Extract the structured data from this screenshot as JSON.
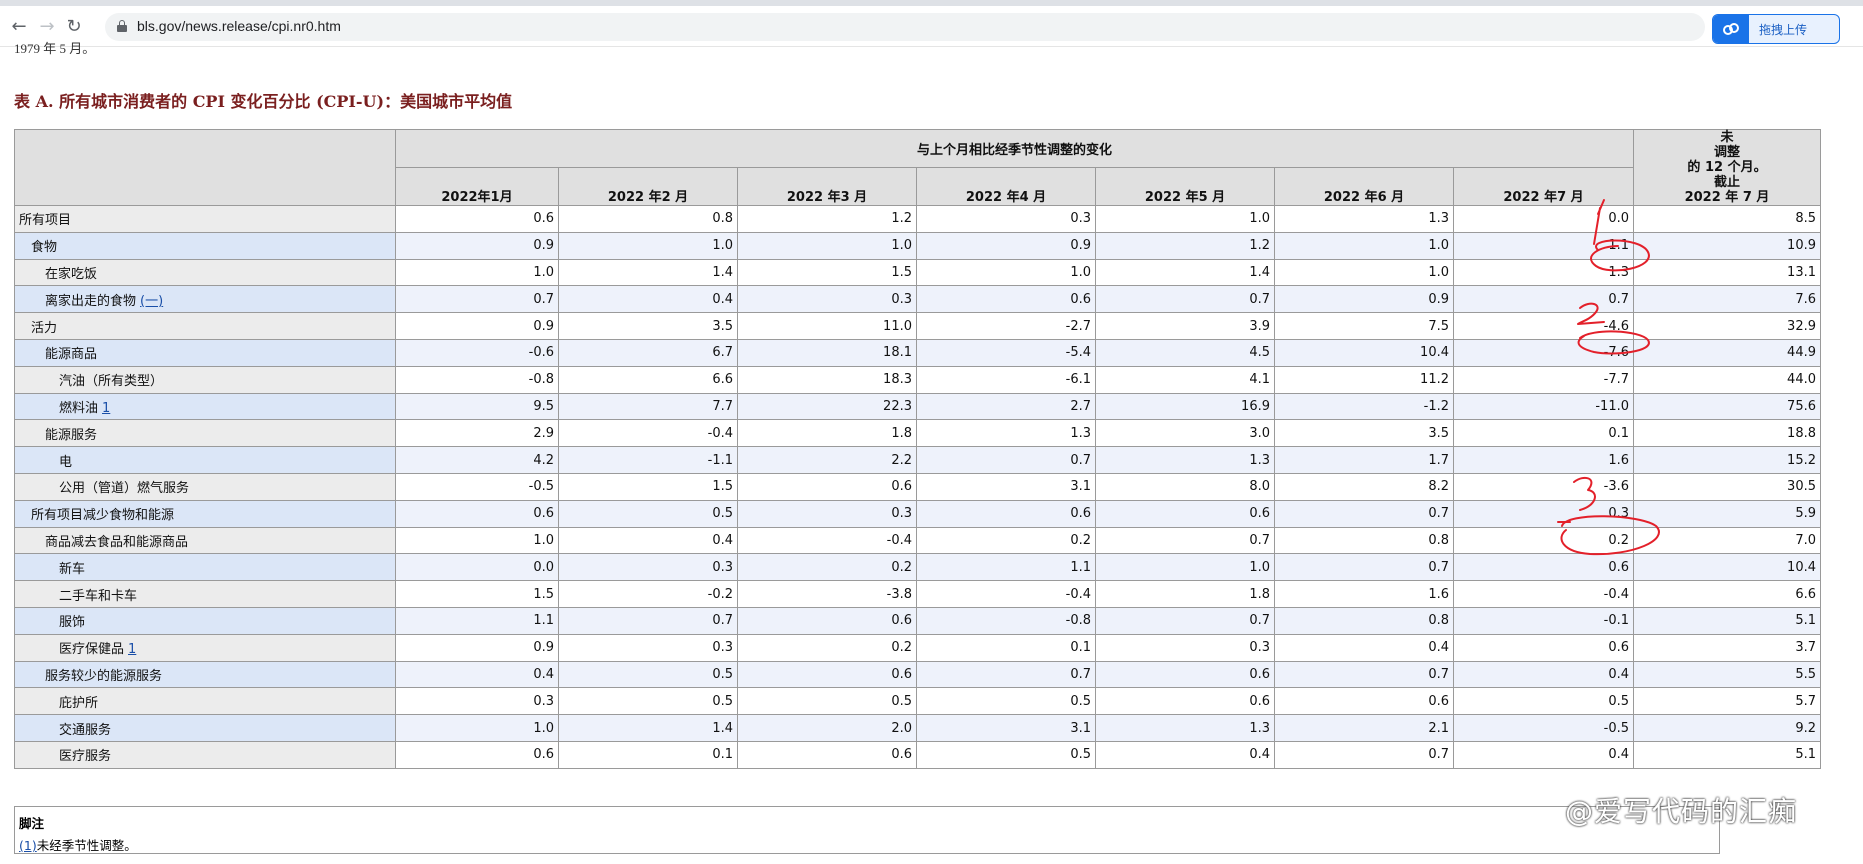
{
  "browser": {
    "url": "bls.gov/news.release/cpi.nr0.htm",
    "upload_label": "拖拽上传"
  },
  "page": {
    "prev_line": "1979 年 5 月。",
    "table_title": "表 A. 所有城市消费者的 CPI 变化百分比 (CPI-U)：美国城市平均值",
    "group_header": "与上个月相比经季节性调整的变化",
    "unadjusted_header": [
      "未",
      "调整",
      "的 12 个月。",
      "截止",
      "2022 年 7 月"
    ],
    "months": [
      "2022年1月",
      "2022 年2 月",
      "2022 年3 月",
      "2022 年4 月",
      "2022 年5 月",
      "2022 年6 月",
      "2022 年7 月"
    ],
    "rows": [
      {
        "label": "所有项目",
        "indent": 0,
        "values": [
          "0.6",
          "0.8",
          "1.2",
          "0.3",
          "1.0",
          "1.3",
          "0.0",
          "8.5"
        ]
      },
      {
        "label": "食物",
        "indent": 1,
        "values": [
          "0.9",
          "1.0",
          "1.0",
          "0.9",
          "1.2",
          "1.0",
          "1.1",
          "10.9"
        ]
      },
      {
        "label": "在家吃饭",
        "indent": 2,
        "values": [
          "1.0",
          "1.4",
          "1.5",
          "1.0",
          "1.4",
          "1.0",
          "1.3",
          "13.1"
        ]
      },
      {
        "label": "离家出走的食物",
        "indent": 2,
        "fn": "(一)",
        "values": [
          "0.7",
          "0.4",
          "0.3",
          "0.6",
          "0.7",
          "0.9",
          "0.7",
          "7.6"
        ]
      },
      {
        "label": "活力",
        "indent": 1,
        "values": [
          "0.9",
          "3.5",
          "11.0",
          "-2.7",
          "3.9",
          "7.5",
          "-4.6",
          "32.9"
        ]
      },
      {
        "label": "能源商品",
        "indent": 2,
        "values": [
          "-0.6",
          "6.7",
          "18.1",
          "-5.4",
          "4.5",
          "10.4",
          "-7.6",
          "44.9"
        ]
      },
      {
        "label": "汽油（所有类型）",
        "indent": 3,
        "values": [
          "-0.8",
          "6.6",
          "18.3",
          "-6.1",
          "4.1",
          "11.2",
          "-7.7",
          "44.0"
        ]
      },
      {
        "label": "燃料油",
        "indent": 3,
        "fn": "1",
        "values": [
          "9.5",
          "7.7",
          "22.3",
          "2.7",
          "16.9",
          "-1.2",
          "-11.0",
          "75.6"
        ]
      },
      {
        "label": "能源服务",
        "indent": 2,
        "values": [
          "2.9",
          "-0.4",
          "1.8",
          "1.3",
          "3.0",
          "3.5",
          "0.1",
          "18.8"
        ]
      },
      {
        "label": "电",
        "indent": 3,
        "values": [
          "4.2",
          "-1.1",
          "2.2",
          "0.7",
          "1.3",
          "1.7",
          "1.6",
          "15.2"
        ]
      },
      {
        "label": "公用（管道）燃气服务",
        "indent": 3,
        "values": [
          "-0.5",
          "1.5",
          "0.6",
          "3.1",
          "8.0",
          "8.2",
          "-3.6",
          "30.5"
        ]
      },
      {
        "label": "所有项目减少食物和能源",
        "indent": 1,
        "values": [
          "0.6",
          "0.5",
          "0.3",
          "0.6",
          "0.6",
          "0.7",
          "0.3",
          "5.9"
        ]
      },
      {
        "label": "商品减去食品和能源商品",
        "indent": 2,
        "values": [
          "1.0",
          "0.4",
          "-0.4",
          "0.2",
          "0.7",
          "0.8",
          "0.2",
          "7.0"
        ]
      },
      {
        "label": "新车",
        "indent": 3,
        "values": [
          "0.0",
          "0.3",
          "0.2",
          "1.1",
          "1.0",
          "0.7",
          "0.6",
          "10.4"
        ]
      },
      {
        "label": "二手车和卡车",
        "indent": 3,
        "values": [
          "1.5",
          "-0.2",
          "-3.8",
          "-0.4",
          "1.8",
          "1.6",
          "-0.4",
          "6.6"
        ]
      },
      {
        "label": "服饰",
        "indent": 3,
        "values": [
          "1.1",
          "0.7",
          "0.6",
          "-0.8",
          "0.7",
          "0.8",
          "-0.1",
          "5.1"
        ]
      },
      {
        "label": "医疗保健品",
        "indent": 3,
        "fn": "1",
        "values": [
          "0.9",
          "0.3",
          "0.2",
          "0.1",
          "0.3",
          "0.4",
          "0.6",
          "3.7"
        ]
      },
      {
        "label": "服务较少的能源服务",
        "indent": 2,
        "values": [
          "0.4",
          "0.5",
          "0.6",
          "0.7",
          "0.6",
          "0.7",
          "0.4",
          "5.5"
        ]
      },
      {
        "label": "庇护所",
        "indent": 3,
        "values": [
          "0.3",
          "0.5",
          "0.5",
          "0.5",
          "0.6",
          "0.6",
          "0.5",
          "5.7"
        ]
      },
      {
        "label": "交通服务",
        "indent": 3,
        "values": [
          "1.0",
          "1.4",
          "2.0",
          "3.1",
          "1.3",
          "2.1",
          "-0.5",
          "9.2"
        ]
      },
      {
        "label": "医疗服务",
        "indent": 3,
        "values": [
          "0.6",
          "0.1",
          "0.6",
          "0.5",
          "0.4",
          "0.7",
          "0.4",
          "5.1"
        ]
      }
    ],
    "footnote_heading": "脚注",
    "footnote_ref": "(1)",
    "footnote_text": "未经季节性调整。",
    "watermark": "@爱写代码的汇痴"
  },
  "colors": {
    "title": "#7a1f1f",
    "header_bg": "#e0e0e0",
    "row_alt": "#eef2fb",
    "annotation": "#e3202a",
    "link": "#1a4fa8"
  }
}
